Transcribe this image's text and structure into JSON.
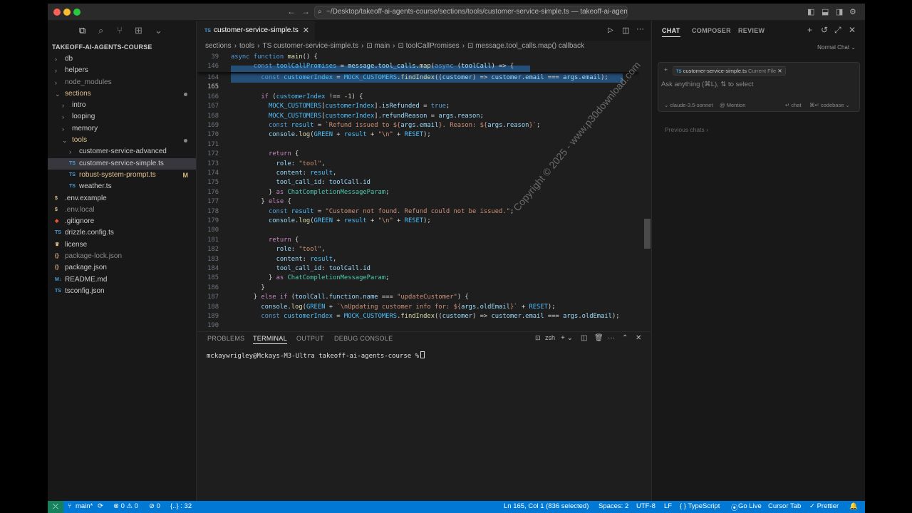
{
  "window": {
    "command_center": "~/Desktop/takeoff-ai-agents-course/sections/tools/customer-service-simple.ts — takeoff-ai-agents-...",
    "nav_back": "←",
    "nav_forward": "→"
  },
  "sidebar": {
    "project_title": "TAKEOFF-AI-AGENTS-COURSE",
    "items": [
      {
        "label": "db",
        "kind": "folder",
        "color": "#cccccc"
      },
      {
        "label": "helpers",
        "kind": "folder",
        "color": "#cccccc"
      },
      {
        "label": "node_modules",
        "kind": "folder",
        "color": "#8b8b8b"
      },
      {
        "label": "sections",
        "kind": "folder-open",
        "color": "#e2c08d"
      },
      {
        "label": "intro",
        "kind": "folder",
        "color": "#cccccc"
      },
      {
        "label": "looping",
        "kind": "folder",
        "color": "#cccccc"
      },
      {
        "label": "memory",
        "kind": "folder",
        "color": "#cccccc"
      },
      {
        "label": "tools",
        "kind": "folder-open",
        "color": "#e2c08d"
      },
      {
        "label": "customer-service-advanced",
        "kind": "folder",
        "color": "#cccccc"
      },
      {
        "label": "customer-service-simple.ts",
        "kind": "ts",
        "color": "#cccccc"
      },
      {
        "label": "robust-system-prompt.ts",
        "kind": "ts",
        "color": "#e2c08d",
        "flag": "M"
      },
      {
        "label": "weather.ts",
        "kind": "ts",
        "color": "#cccccc"
      },
      {
        "label": ".env.example",
        "kind": "env",
        "color": "#cccccc"
      },
      {
        "label": ".env.local",
        "kind": "env",
        "color": "#8b8b8b"
      },
      {
        "label": ".gitignore",
        "kind": "git",
        "color": "#cccccc"
      },
      {
        "label": "drizzle.config.ts",
        "kind": "ts",
        "color": "#cccccc"
      },
      {
        "label": "license",
        "kind": "license",
        "color": "#cccccc"
      },
      {
        "label": "package-lock.json",
        "kind": "json",
        "color": "#8b8b8b"
      },
      {
        "label": "package.json",
        "kind": "json",
        "color": "#cccccc"
      },
      {
        "label": "README.md",
        "kind": "md",
        "color": "#cccccc"
      },
      {
        "label": "tsconfig.json",
        "kind": "tsconfig",
        "color": "#cccccc"
      }
    ]
  },
  "editor": {
    "tab_label": "customer-service-simple.ts",
    "tab_type": "TS",
    "breadcrumbs": [
      "sections",
      "›",
      "tools",
      "›",
      "TS customer-service-simple.ts",
      "›",
      "⊡ main",
      "›",
      "⊡ toolCallPromises",
      "›",
      "⊡ message.tool_calls.map() callback"
    ],
    "watermark": "Copyright © 2025 - www.p30download.com",
    "lines": [
      {
        "n": "39",
        "html": "<span class='bl'>async</span> <span class='bl'>function</span> <span class='fn'>main</span>() {"
      },
      {
        "n": "146",
        "html": "      <span class='bl'>const</span> <span class='cn'>toolCallPromises</span> = <span class='vr'>message</span>.<span class='vr'>tool_calls</span>.<span class='fn'>map</span>(<span class='bl'>async</span> (<span class='vr'>toolCall</span>) => {"
      },
      {
        "n": "164",
        "html": "        <span class='bl'>const</span> <span class='cn'>customerIndex</span> = <span class='cn'>MOCK_CUSTOMERS</span>.<span class='fn'>findIndex</span>((<span class='vr'>customer</span>) => <span class='vr'>customer</span>.<span class='vr'>email</span> === <span class='vr'>args</span>.<span class='vr'>email</span>);"
      },
      {
        "n": "165",
        "html": ""
      },
      {
        "n": "166",
        "html": "        <span class='kw'>if</span> (<span class='cn'>customerIndex</span> !== -<span class='nm'>1</span>) {"
      },
      {
        "n": "167",
        "html": "          <span class='cn'>MOCK_CUSTOMERS</span>[<span class='cn'>customerIndex</span>].<span class='vr'>isRefunded</span> = <span class='bl'>true</span>;"
      },
      {
        "n": "168",
        "html": "          <span class='cn'>MOCK_CUSTOMERS</span>[<span class='cn'>customerIndex</span>].<span class='vr'>refundReason</span> = <span class='vr'>args</span>.<span class='vr'>reason</span>;"
      },
      {
        "n": "169",
        "html": "          <span class='bl'>const</span> <span class='cn'>result</span> = <span class='st'>`Refund issued to ${</span><span class='vr'>args</span>.<span class='vr'>email</span><span class='st'>}. Reason: ${</span><span class='vr'>args</span>.<span class='vr'>reason</span><span class='st'>}`</span>;"
      },
      {
        "n": "170",
        "html": "          <span class='vr'>console</span>.<span class='fn'>log</span>(<span class='cn'>GREEN</span> + <span class='cn'>result</span> + <span class='st'>\"\\n\"</span> + <span class='cn'>RESET</span>);"
      },
      {
        "n": "171",
        "html": ""
      },
      {
        "n": "172",
        "html": "          <span class='kw'>return</span> {"
      },
      {
        "n": "173",
        "html": "            <span class='vr'>role</span>: <span class='st'>\"tool\"</span>,"
      },
      {
        "n": "174",
        "html": "            <span class='vr'>content</span>: <span class='cn'>result</span>,"
      },
      {
        "n": "175",
        "html": "            <span class='vr'>tool_call_id</span>: <span class='vr'>toolCall</span>.<span class='vr'>id</span>"
      },
      {
        "n": "176",
        "html": "          } <span class='kw'>as</span> <span class='ty'>ChatCompletionMessageParam</span>;"
      },
      {
        "n": "177",
        "html": "        } <span class='kw'>else</span> {"
      },
      {
        "n": "178",
        "html": "          <span class='bl'>const</span> <span class='cn'>result</span> = <span class='st'>\"Customer not found. Refund could not be issued.\"</span>;"
      },
      {
        "n": "179",
        "html": "          <span class='vr'>console</span>.<span class='fn'>log</span>(<span class='cn'>GREEN</span> + <span class='cn'>result</span> + <span class='st'>\"\\n\"</span> + <span class='cn'>RESET</span>);"
      },
      {
        "n": "180",
        "html": ""
      },
      {
        "n": "181",
        "html": "          <span class='kw'>return</span> {"
      },
      {
        "n": "182",
        "html": "            <span class='vr'>role</span>: <span class='st'>\"tool\"</span>,"
      },
      {
        "n": "183",
        "html": "            <span class='vr'>content</span>: <span class='cn'>result</span>,"
      },
      {
        "n": "184",
        "html": "            <span class='vr'>tool_call_id</span>: <span class='vr'>toolCall</span>.<span class='vr'>id</span>"
      },
      {
        "n": "185",
        "html": "          } <span class='kw'>as</span> <span class='ty'>ChatCompletionMessageParam</span>;"
      },
      {
        "n": "186",
        "html": "        }"
      },
      {
        "n": "187",
        "html": "      } <span class='kw'>else if</span> (<span class='vr'>toolCall</span>.<span class='vr'>function</span>.<span class='vr'>name</span> === <span class='st'>\"updateCustomer\"</span>) {"
      },
      {
        "n": "188",
        "html": "        <span class='vr'>console</span>.<span class='fn'>log</span>(<span class='cn'>GREEN</span> + <span class='st'>`\\nUpdating customer info for: ${</span><span class='vr'>args</span>.<span class='vr'>oldEmail</span><span class='st'>}`</span> + <span class='cn'>RESET</span>);"
      },
      {
        "n": "189",
        "html": "        <span class='bl'>const</span> <span class='cn'>customerIndex</span> = <span class='cn'>MOCK_CUSTOMERS</span>.<span class='fn'>findIndex</span>((<span class='vr'>customer</span>) => <span class='vr'>customer</span>.<span class='vr'>email</span> === <span class='vr'>args</span>.<span class='vr'>oldEmail</span>);"
      },
      {
        "n": "190",
        "html": ""
      }
    ]
  },
  "panel": {
    "tabs": [
      "PROBLEMS",
      "TERMINAL",
      "OUTPUT",
      "DEBUG CONSOLE"
    ],
    "active_tab": "TERMINAL",
    "shell": "zsh",
    "prompt": "mckaywrigley@Mckays-M3-Ultra takeoff-ai-agents-course %"
  },
  "chat": {
    "tabs": [
      "CHAT",
      "COMPOSER",
      "REVIEW"
    ],
    "active_tab": "CHAT",
    "mode": "Normal Chat ⌄",
    "file_chip": "customer-service-simple.ts",
    "file_chip_tag": "Current File",
    "placeholder": "Ask anything (⌘L), ⇅ to select",
    "model": "⌄ claude-3.5-sonnet",
    "mention": "@ Mention",
    "chat_action": "↵ chat",
    "codebase_action": "⌘↵ codebase ⌄",
    "previous_chats": "Previous chats ›"
  },
  "statusbar": {
    "branch": "main*",
    "errors": "⊗ 0 ⚠ 0",
    "ports": "⊘ 0",
    "extra": "{..} : 32",
    "cursor": "Ln 165, Col 1 (836 selected)",
    "spaces": "Spaces: 2",
    "encoding": "UTF-8",
    "eol": "LF",
    "language": "{ } TypeScript",
    "golive": "Go Live",
    "cursor_tab": "Cursor Tab",
    "prettier": "✓ Prettier"
  },
  "colors": {
    "accent": "#0078d4",
    "remote": "#16825d",
    "selection": "#264f78"
  }
}
